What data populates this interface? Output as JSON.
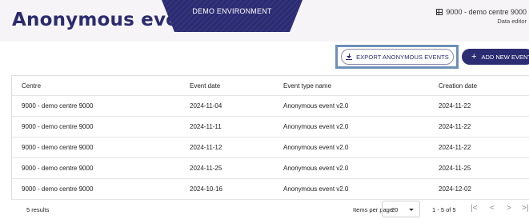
{
  "header": {
    "title": "Anonymous events",
    "banner": "DEMO ENVIRONMENT",
    "centre": "9000 - demo centre 9000",
    "role": "Data editor",
    "centre_icon": "grid-icon"
  },
  "toolbar": {
    "export_label": "EXPORT ANONYMOUS EVENTS",
    "export_icon": "download-icon",
    "add_label": "ADD NEW EVENT",
    "add_icon": "plus-icon"
  },
  "table": {
    "columns": [
      "Centre",
      "Event date",
      "Event type name",
      "Creation date"
    ],
    "rows": [
      [
        "9000 - demo centre 9000",
        "2024-11-04",
        "Anonymous event v2.0",
        "2024-11-22"
      ],
      [
        "9000 - demo centre 9000",
        "2024-11-11",
        "Anonymous event v2.0",
        "2024-11-22"
      ],
      [
        "9000 - demo centre 9000",
        "2024-11-12",
        "Anonymous event v2.0",
        "2024-11-22"
      ],
      [
        "9000 - demo centre 9000",
        "2024-11-25",
        "Anonymous event v2.0",
        "2024-11-25"
      ],
      [
        "9000 - demo centre 9000",
        "2024-10-16",
        "Anonymous event v2.0",
        "2024-12-02"
      ]
    ]
  },
  "footer": {
    "results": "5 results",
    "items_per_page_label": "Items per page:",
    "items_per_page": "20",
    "range": "1 - 5 of 5",
    "first": "|<",
    "prev": "<",
    "next": ">",
    "last": ">|"
  },
  "colors": {
    "brand": "#2b2b6e",
    "banner": "#2c2c72",
    "highlight": "#6d8fb8",
    "header_bg": "#f6f4f6"
  }
}
